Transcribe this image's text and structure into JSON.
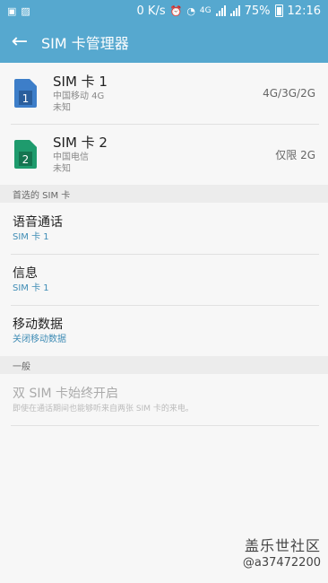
{
  "status_bar": {
    "network_speed": "0 K/s",
    "network_type": "4G",
    "battery": "75%",
    "time": "12:16"
  },
  "app_bar": {
    "title": "SIM 卡管理器"
  },
  "sims": [
    {
      "name": "SIM 卡 1",
      "number": "1",
      "carrier": "中国移动 4G",
      "status": "未知",
      "network": "4G/3G/2G",
      "color": "#3d7ec9"
    },
    {
      "name": "SIM 卡 2",
      "number": "2",
      "carrier": "中国电信",
      "status": "未知",
      "network": "仅限 2G",
      "color": "#1e9b6d"
    }
  ],
  "preferred_section": {
    "header": "首选的 SIM 卡",
    "items": [
      {
        "title": "语音通话",
        "value": "SIM 卡 1"
      },
      {
        "title": "信息",
        "value": "SIM 卡 1"
      },
      {
        "title": "移动数据",
        "value": "关闭移动数据"
      }
    ]
  },
  "general_section": {
    "header": "一般",
    "dual_sim_title": "双 SIM 卡始终开启",
    "dual_sim_desc": "即使在通话期间也能够听来自两张 SIM 卡的来电。"
  },
  "watermark": {
    "logo": "盖乐世社区",
    "user": "@a37472200"
  }
}
